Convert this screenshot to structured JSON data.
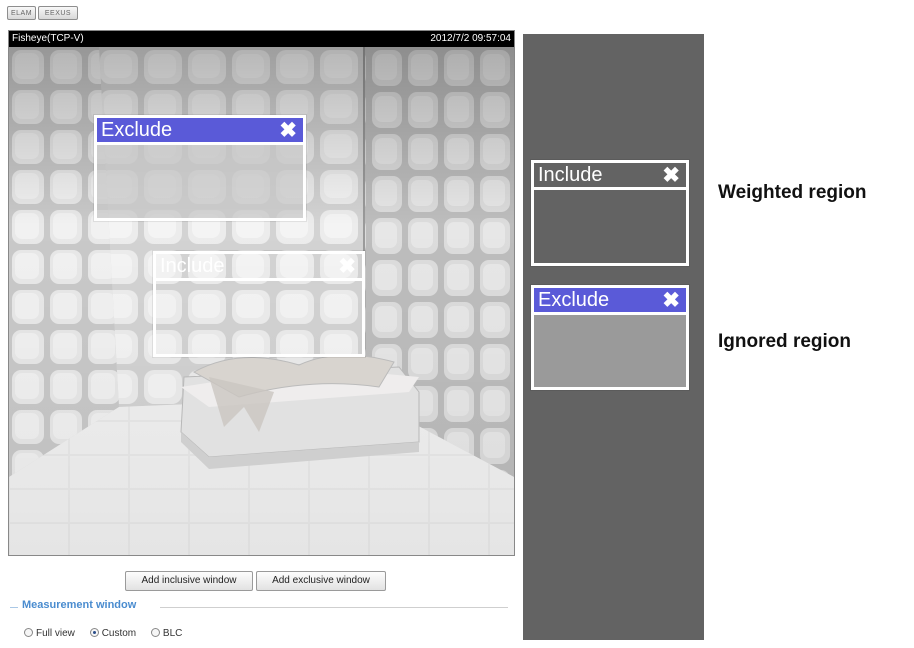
{
  "toolbar": {
    "btn1": "ELAM",
    "btn2": "EEXUS"
  },
  "video": {
    "camera_label": "Fisheye(TCP-V)",
    "timestamp": "2012/7/2 09:57:04"
  },
  "regions": {
    "exclude_label": "Exclude",
    "include_label": "Include",
    "close_glyph": "✖"
  },
  "legend": {
    "include_label": "Include",
    "exclude_label": "Exclude",
    "weighted_text": "Weighted region",
    "ignored_text": "Ignored region"
  },
  "buttons": {
    "add_inclusive": "Add inclusive window",
    "add_exclusive": "Add exclusive window"
  },
  "measurement": {
    "title": "Measurement window",
    "options": [
      "Full view",
      "Custom",
      "BLC"
    ],
    "selected": "Custom"
  },
  "colors": {
    "exclude_bar": "#5a5ad8",
    "legend_panel": "#636363",
    "section_title": "#4a8ccf"
  }
}
